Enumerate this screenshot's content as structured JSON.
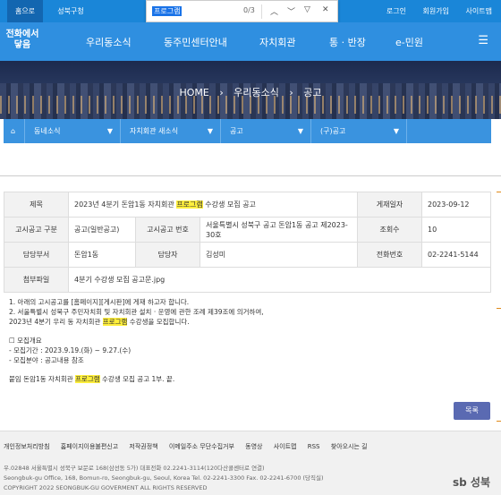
{
  "topbar": {
    "home": "홈으로",
    "gu": "성북구청",
    "links": [
      "로그인",
      "회원가입",
      "사이트맵"
    ]
  },
  "find": {
    "query": "프로그램",
    "count": "0/3"
  },
  "logo": {
    "line1": "전화에서",
    "line2": "닿음"
  },
  "nav": [
    "우리동소식",
    "동주민센터안내",
    "자치회관",
    "통 · 반장",
    "e-민원"
  ],
  "breadcrumb": [
    "HOME",
    "우리동소식",
    "공고"
  ],
  "subnav": [
    "동네소식",
    "자치회관 새소식",
    "공고",
    "(구)공고"
  ],
  "post": {
    "labels": {
      "title": "제목",
      "date": "게재일자",
      "type": "고시공고 구분",
      "number": "고시공고 번호",
      "views": "조회수",
      "dept": "담당부서",
      "manager": "담당자",
      "phone": "전화번호",
      "attach": "첨부파일"
    },
    "title_pre": "2023년 4분기 돈암1동 자치회관 ",
    "title_hl": "프로그램",
    "title_post": " 수강생 모집 공고",
    "date": "2023-09-12",
    "type": "공고(일반공고)",
    "number": "서울특별시 성북구 공고 돈암1동 공고 제2023-30호",
    "views": "10",
    "dept": "돈암1동",
    "manager": "김성미",
    "phone": "02-2241-5144",
    "attachment": "4분기 수강생 모집 공고문.jpg"
  },
  "body": {
    "l1": "1. 아래의 고시공고를 [홈페이지][게시판]에 게재 하고자 합니다.",
    "l2": "2. 서울특별시 성북구 주민자치회 및 자치회관 설치 · 운영에 관한 조례 제39조에 의거하여,",
    "l3_pre": "2023년 4분기 우리 동 자치회관 ",
    "l3_hl": "프로그램",
    "l3_post": " 수강생을 모집합니다.",
    "l4": "☐ 모집개요",
    "l5": "- 모집기간 : 2023.9.19.(화) ~ 9.27.(수)",
    "l6": "- 모집분야 : 공고내용 참조",
    "l7_pre": "붙임 돈암1동 자치회관 ",
    "l7_hl": "프로그램",
    "l7_post": " 수강생 모집 공고 1부. 끝."
  },
  "list_button": "목록",
  "footer": {
    "links": [
      "개인정보처리방침",
      "홈페이지이용불편신고",
      "저작권정책",
      "이메일주소 무단수집거부",
      "동영상",
      "사이트맵",
      "RSS",
      "찾아오시는 길"
    ],
    "addr1": "우.02848 서울특별시 성북구 보문로 168(삼선동 5가) 대표전화 02.2241-3114(120다산콜센터로 연결)",
    "addr2": "Seongbuk-gu Office, 168, Bomun-ro, Seongbuk-gu, Seoul, Korea Tel. 02-2241-3300 Fax. 02-2241-6700 (당직실)",
    "copy": "COPYRIGHT 2022 SEONGBUK-GU GOVERMENT ALL RIGHTS RESERVED",
    "logo": "sb 성북"
  },
  "colors": {
    "primary": "#2f8fe0",
    "highlight": "#ffef3c",
    "button": "#5a6ab2"
  }
}
